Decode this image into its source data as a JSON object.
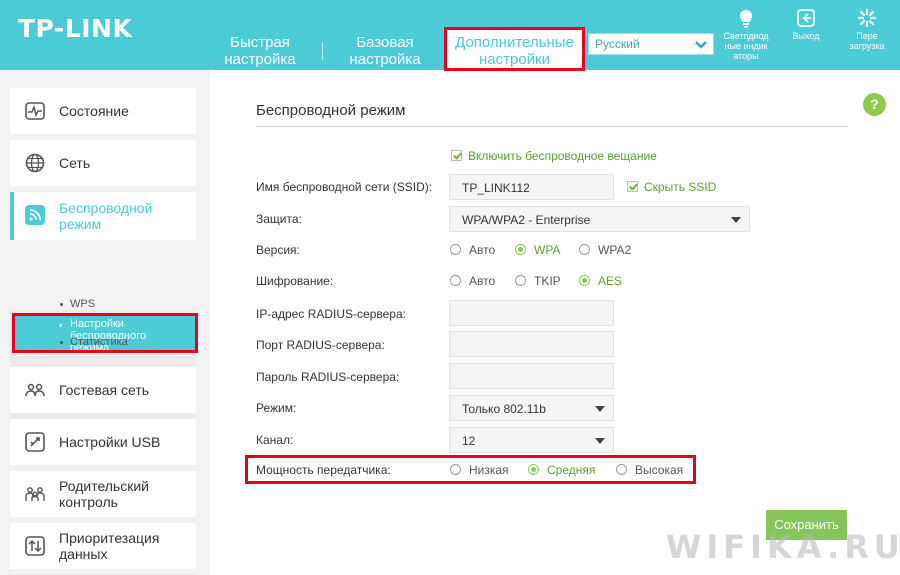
{
  "brand": {
    "logo": "TP-LINK"
  },
  "nav": {
    "tab1": "Быстрая настройка",
    "tab2": "Базовая настройка",
    "tab3": "Дополнительные настройки",
    "language": "Русский",
    "leds": "Светодиод ные индик аторы",
    "logout": "Выход",
    "reboot": "Пере загрузка"
  },
  "sidebar": {
    "status": "Состояние",
    "network": "Сеть",
    "wireless": "Беспроводной режим",
    "sub_settings": "Настройки беспроводного режима",
    "sub_wps": "WPS",
    "sub_stats": "Статистика",
    "guest": "Гостевая сеть",
    "usb": "Настройки USB",
    "parental": "Родительский контроль",
    "qos": "Приоритезация данных"
  },
  "main": {
    "title": "Беспроводной режим",
    "enable_broadcast": "Включить беспроводное вещание",
    "ssid_label": "Имя беспроводной сети (SSID):",
    "ssid_value": "TP_LINK112",
    "hide_ssid": "Скрыть SSID",
    "security_label": "Защита:",
    "security_value": "WPA/WPA2 - Enterprise",
    "version_label": "Версия:",
    "version_options": {
      "auto": "Авто",
      "wpa": "WPA",
      "wpa2": "WPA2"
    },
    "encryption_label": "Шифрование:",
    "encryption_options": {
      "auto": "Авто",
      "tkip": "TKIP",
      "aes": "AES"
    },
    "radius_ip_label": "IP-адрес RADIUS-сервера:",
    "radius_port_label": "Порт RADIUS-сервера:",
    "radius_pass_label": "Пароль RADIUS-сервера:",
    "mode_label": "Режим:",
    "mode_value": "Только 802.11b",
    "channel_label": "Канал:",
    "channel_value": "12",
    "power_label": "Мощность передатчика:",
    "power_options": {
      "low": "Низкая",
      "medium": "Средняя",
      "high": "Высокая"
    },
    "save": "Сохранить"
  },
  "watermark": "WIFIKA.RU",
  "colors": {
    "brand": "#4acbd6",
    "highlight": "#e8001c",
    "accent_green": "#8fca4f"
  }
}
